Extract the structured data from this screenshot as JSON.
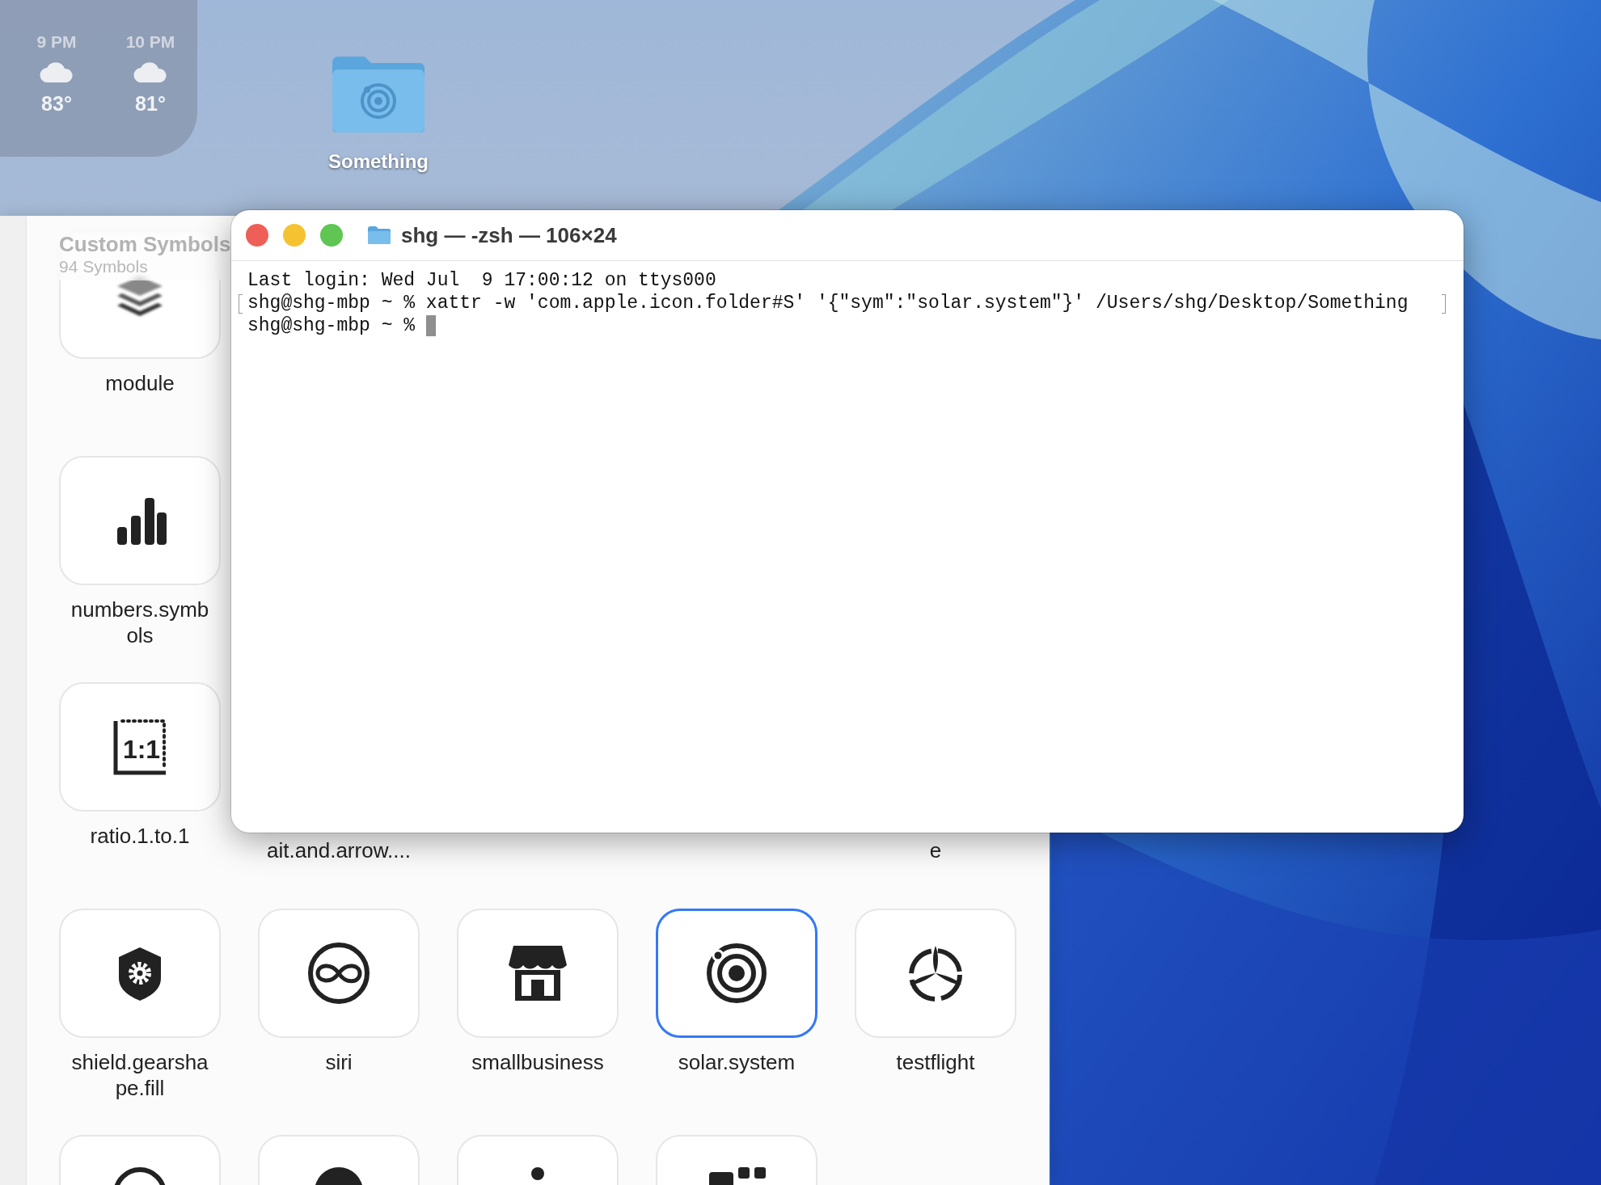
{
  "weather": {
    "hours": [
      {
        "time": "9 PM",
        "temp": "83°"
      },
      {
        "time": "10 PM",
        "temp": "81°"
      }
    ]
  },
  "desktop_folder": {
    "label": "Something"
  },
  "symbols_window": {
    "title": "Custom Symbols",
    "count": "94 Symbols",
    "rows": [
      {
        "items": [
          {
            "kind": "tile",
            "label": "module",
            "selected": false
          }
        ]
      },
      {
        "items": [
          {
            "kind": "tile",
            "label": "numbers.symbols",
            "selected": false
          }
        ]
      },
      {
        "items": [
          {
            "kind": "tile",
            "label": "ratio.1.to.1",
            "selected": false,
            "glyph": "1:1"
          },
          {
            "kind": "caption",
            "label": "ait.and.arrow...."
          },
          {
            "kind": "caption"
          },
          {
            "kind": "caption"
          },
          {
            "kind": "caption",
            "label": "e"
          }
        ]
      },
      {
        "items": [
          {
            "kind": "tile",
            "label": "shield.gearshape.fill",
            "selected": false
          },
          {
            "kind": "tile",
            "label": "siri",
            "selected": false
          },
          {
            "kind": "tile",
            "label": "smallbusiness",
            "selected": false
          },
          {
            "kind": "tile",
            "label": "solar.system",
            "selected": true
          },
          {
            "kind": "tile",
            "label": "testflight",
            "selected": false
          }
        ]
      },
      {
        "items": [
          {
            "kind": "tile",
            "selected": false
          },
          {
            "kind": "tile",
            "selected": false
          },
          {
            "kind": "tile",
            "selected": false
          },
          {
            "kind": "tile",
            "selected": false
          }
        ]
      }
    ]
  },
  "terminal": {
    "title": "shg — -zsh — 106×24",
    "lines": [
      {
        "text": "Last login: Wed Jul  9 17:00:12 on ttys000",
        "marked": false,
        "cursor": false
      },
      {
        "text": "shg@shg-mbp ~ % xattr -w 'com.apple.icon.folder#S' '{\"sym\":\"solar.system\"}' /Users/shg/Desktop/Something",
        "marked": true,
        "cursor": false
      },
      {
        "text": "shg@shg-mbp ~ % ",
        "marked": false,
        "cursor": true
      }
    ]
  }
}
